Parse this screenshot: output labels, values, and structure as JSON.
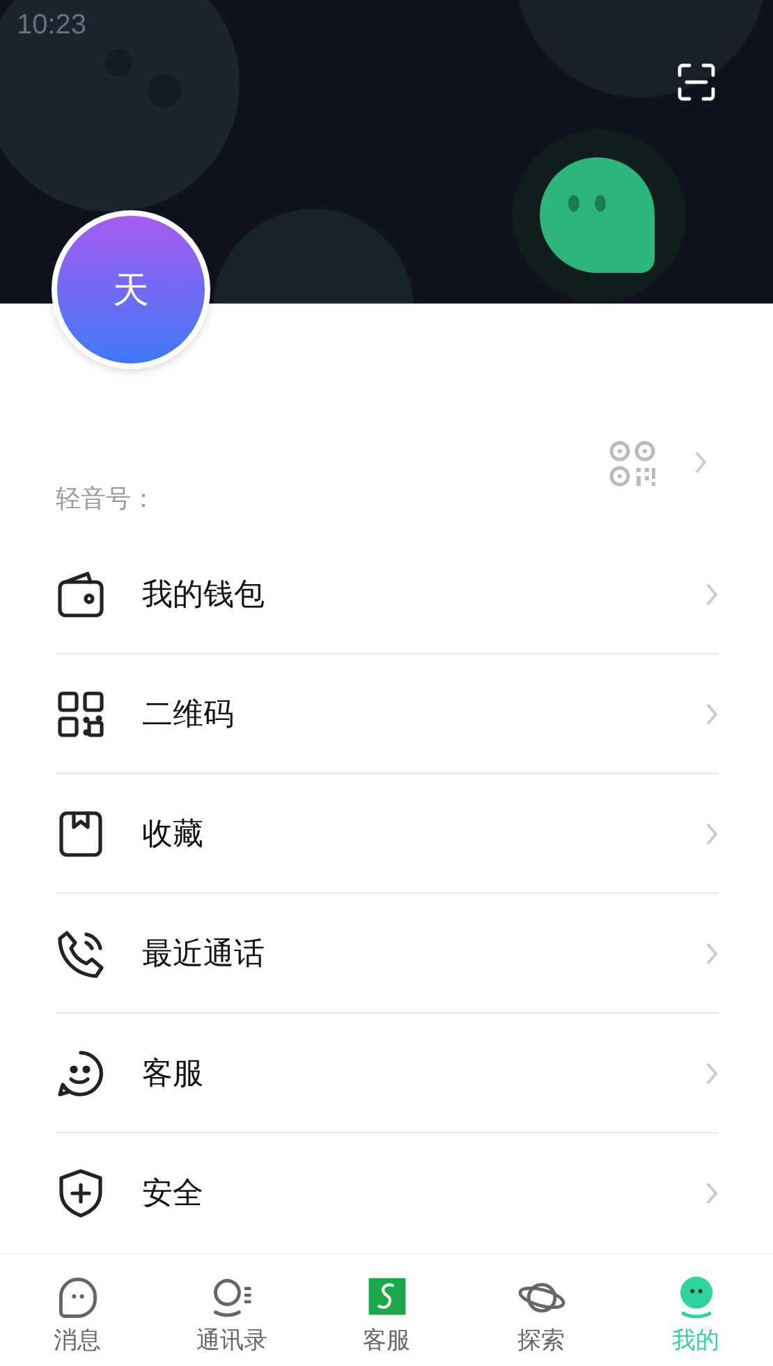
{
  "status_bar": {
    "time": "10:23"
  },
  "profile": {
    "avatar_text": "天",
    "id_label": "轻音号："
  },
  "menu": [
    {
      "label": "我的钱包"
    },
    {
      "label": "二维码"
    },
    {
      "label": "收藏"
    },
    {
      "label": "最近通话"
    },
    {
      "label": "客服"
    },
    {
      "label": "安全"
    }
  ],
  "tabs": [
    {
      "label": "消息",
      "selected": false
    },
    {
      "label": "通讯录",
      "selected": false
    },
    {
      "label": "客服",
      "selected": false
    },
    {
      "label": "探索",
      "selected": false
    },
    {
      "label": "我的",
      "selected": true
    }
  ]
}
